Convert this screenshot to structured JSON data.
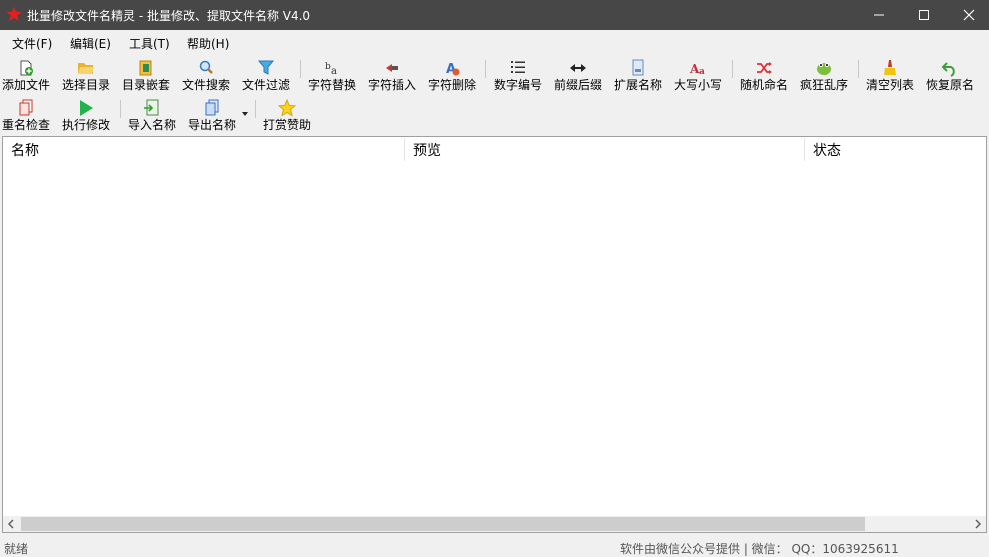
{
  "window": {
    "title": "批量修改文件名精灵 - 批量修改、提取文件名称  V4.0",
    "icon": "red-star-icon",
    "controls": [
      "minimize-icon",
      "maximize-icon",
      "close-icon"
    ]
  },
  "menu": [
    {
      "label": "文件(F)"
    },
    {
      "label": "编辑(E)"
    },
    {
      "label": "工具(T)"
    },
    {
      "label": "帮助(H)"
    }
  ],
  "toolbar": {
    "row1": [
      {
        "label": "添加文件",
        "icon": "add-file-icon"
      },
      {
        "label": "选择目录",
        "icon": "open-folder-icon"
      },
      {
        "label": "目录嵌套",
        "icon": "nested-folder-icon"
      },
      {
        "label": "文件搜索",
        "icon": "magnifier-icon"
      },
      {
        "label": "文件过滤",
        "icon": "funnel-icon"
      },
      {
        "label": "字符替换",
        "icon": "replace-chars-icon"
      },
      {
        "label": "字符插入",
        "icon": "insert-chars-icon"
      },
      {
        "label": "字符删除",
        "icon": "delete-chars-icon"
      },
      {
        "label": "数字编号",
        "icon": "numbered-list-icon"
      },
      {
        "label": "前缀后缀",
        "icon": "prefix-suffix-arrows-icon"
      },
      {
        "label": "扩展名称",
        "icon": "extension-icon"
      },
      {
        "label": "大写小写",
        "icon": "uppercase-lowercase-icon"
      },
      {
        "label": "随机命名",
        "icon": "shuffle-icon"
      },
      {
        "label": "疯狂乱序",
        "icon": "frog-icon"
      },
      {
        "label": "清空列表",
        "icon": "broom-icon"
      },
      {
        "label": "恢复原名",
        "icon": "undo-arrow-icon"
      }
    ],
    "row2": [
      {
        "label": "重名检查",
        "icon": "duplicate-check-icon"
      },
      {
        "label": "执行修改",
        "icon": "play-icon"
      },
      {
        "label": "导入名称",
        "icon": "import-names-icon"
      },
      {
        "label": "导出名称",
        "icon": "export-names-icon"
      },
      {
        "label": "打赏赞助",
        "icon": "star-icon"
      }
    ]
  },
  "list": {
    "columns": [
      "名称",
      "预览",
      "状态"
    ],
    "rows": []
  },
  "statusbar": {
    "left_text": "就绪",
    "right_text": "软件由微信公众号提供 | 微信：  QQ：1063925611"
  },
  "colors": {
    "titlebar": "#474747",
    "background": "#f0f0f0",
    "list_background": "#ffffff",
    "scroll_thumb": "#cdcdcd"
  }
}
